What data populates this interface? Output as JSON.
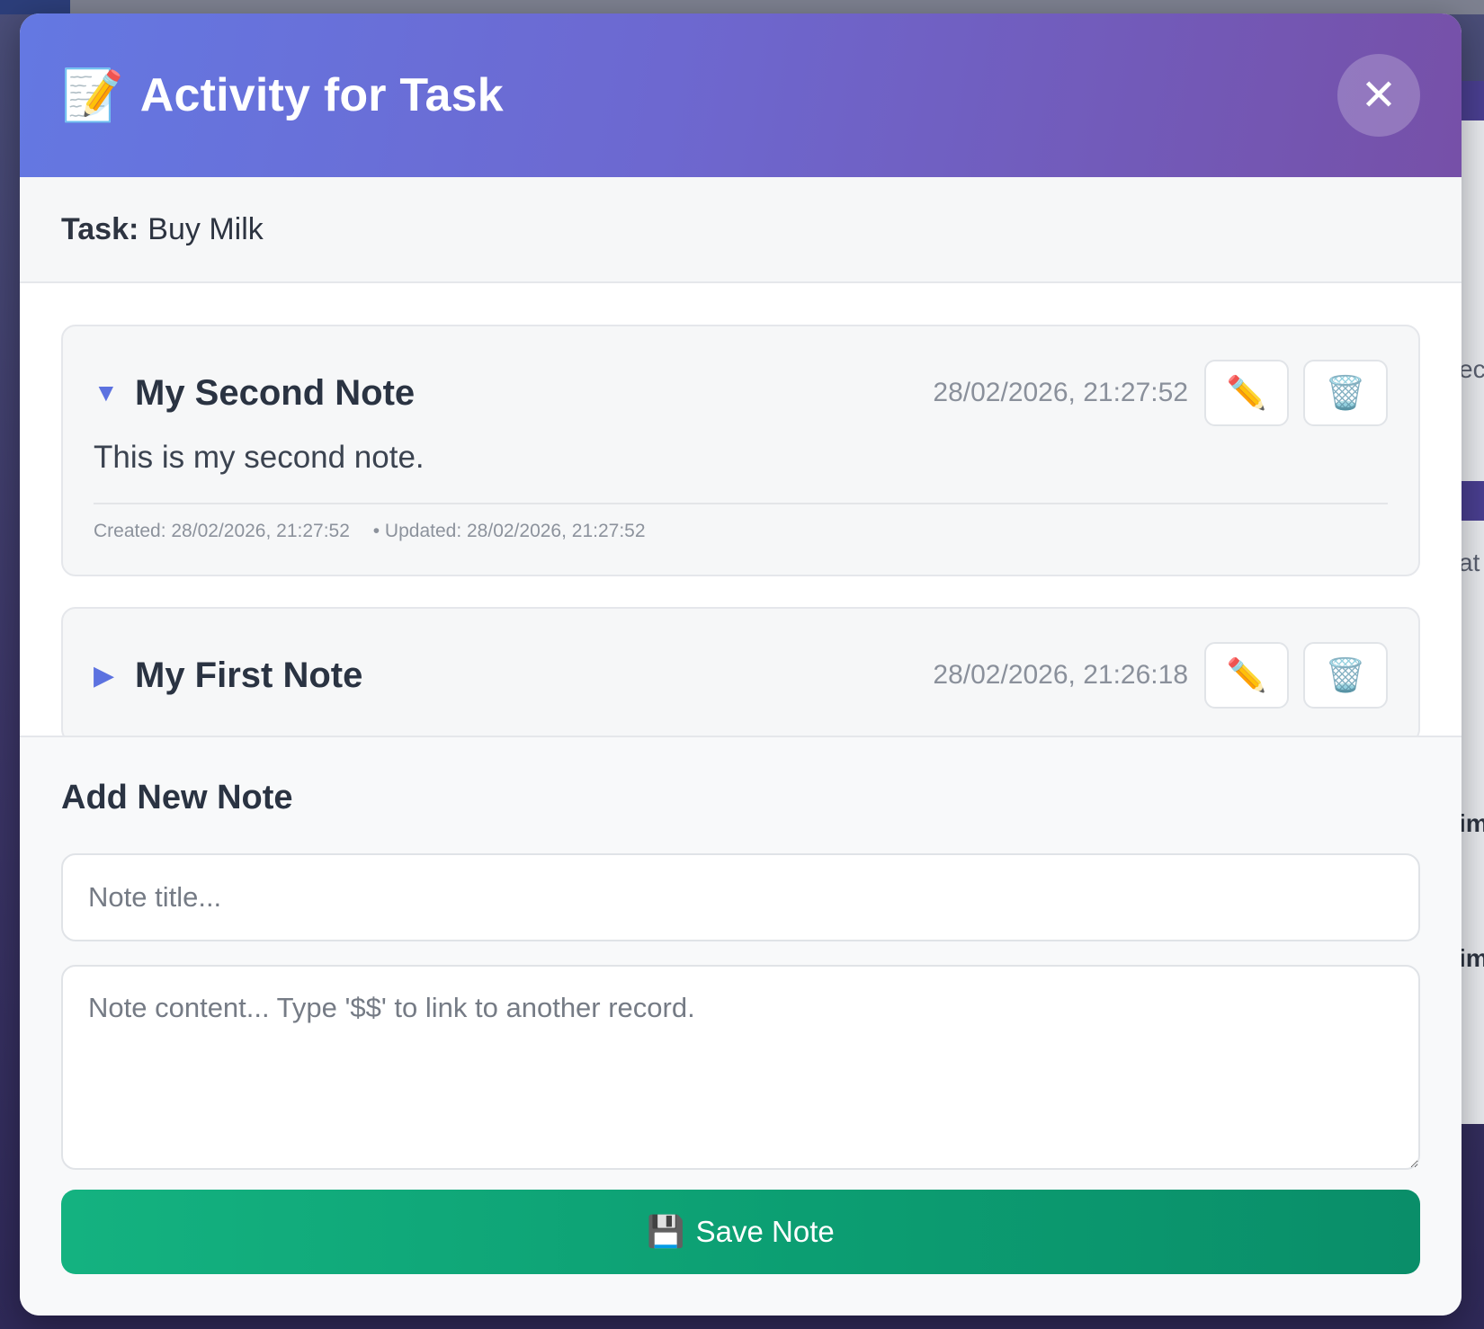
{
  "modal": {
    "title_icon": "📝",
    "title": "Activity for Task",
    "close_label": "✕"
  },
  "task": {
    "label": "Task:",
    "name": "Buy Milk"
  },
  "notes": [
    {
      "title": "My Second Note",
      "timestamp": "28/02/2026, 21:27:52",
      "expanded": true,
      "caret": "▼",
      "body": "This is my second note.",
      "created": "Created: 28/02/2026, 21:27:52",
      "updated": "• Updated: 28/02/2026, 21:27:52",
      "edit_icon": "✏️",
      "delete_icon": "🗑️"
    },
    {
      "title": "My First Note",
      "timestamp": "28/02/2026, 21:26:18",
      "expanded": false,
      "caret": "▶",
      "edit_icon": "✏️",
      "delete_icon": "🗑️"
    }
  ],
  "add_note": {
    "heading": "Add New Note",
    "title_placeholder": "Note title...",
    "content_placeholder": "Note content... Type '$$' to link to another record.",
    "save_icon": "💾",
    "save_label": "Save Note"
  },
  "colors": {
    "header_start": "#6478e2",
    "header_end": "#7650a8",
    "caret": "#5c72e0",
    "save_start": "#14b280",
    "save_end": "#0a8e69"
  },
  "background": {
    "fragments": [
      "ec",
      "at",
      "im",
      "im"
    ]
  }
}
